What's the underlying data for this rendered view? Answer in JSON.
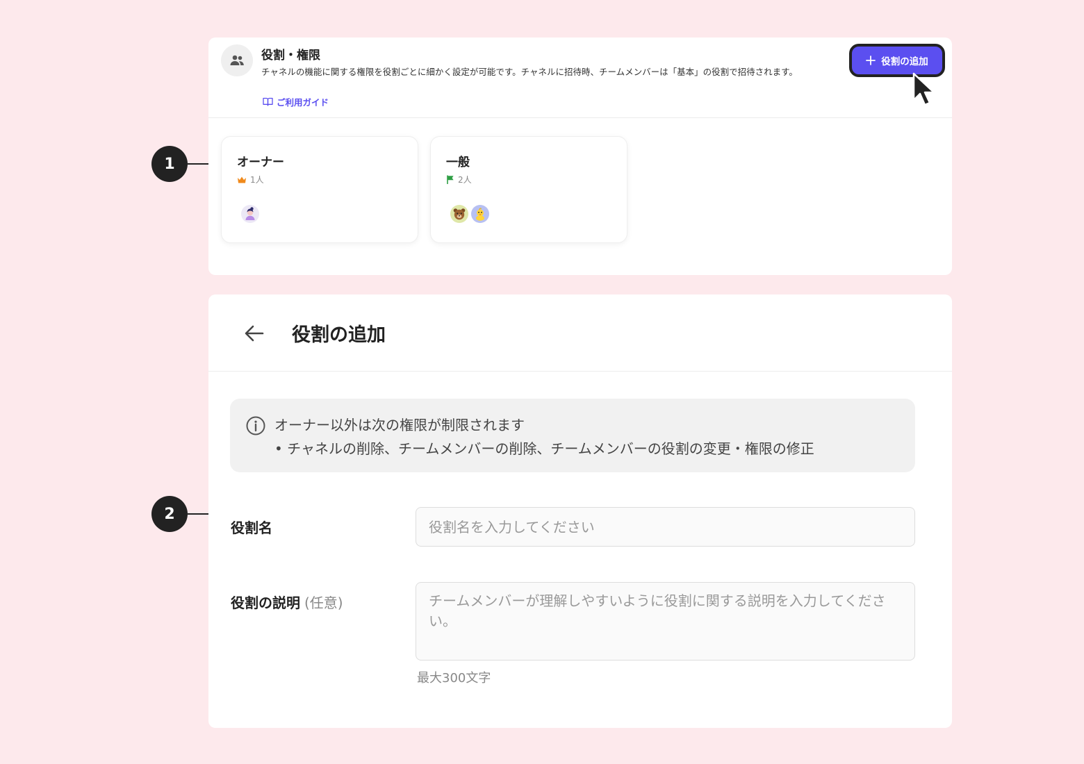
{
  "roles_panel": {
    "title": "役割・権限",
    "description": "チャネルの機能に関する権限を役割ごとに細かく設定が可能です。チャネルに招待時、チームメンバーは「基本」の役割で招待されます。",
    "guide_link": "ご利用ガイド",
    "add_button": "役割の追加",
    "cards": [
      {
        "name": "オーナー",
        "count": "1人",
        "badge_icon": "crown-icon",
        "badge_color": "#f08a1c"
      },
      {
        "name": "一般",
        "count": "2人",
        "badge_icon": "flag-icon",
        "badge_color": "#2e9e44"
      }
    ]
  },
  "markers": [
    "1",
    "2"
  ],
  "form_panel": {
    "title": "役割の追加",
    "notice": {
      "line1": "オーナー以外は次の権限が制限されます",
      "line2": "• チャネルの削除、チームメンバーの削除、チームメンバーの役割の変更・権限の修正"
    },
    "name_label": "役割名",
    "name_placeholder": "役割名を入力してください",
    "desc_label": "役割の説明",
    "desc_optional": "(任意)",
    "desc_placeholder": "チームメンバーが理解しやすいように役割に関する説明を入力してください。",
    "char_limit": "最大300文字"
  },
  "colors": {
    "background": "#fde9ec",
    "accent": "#5b4ff0"
  }
}
